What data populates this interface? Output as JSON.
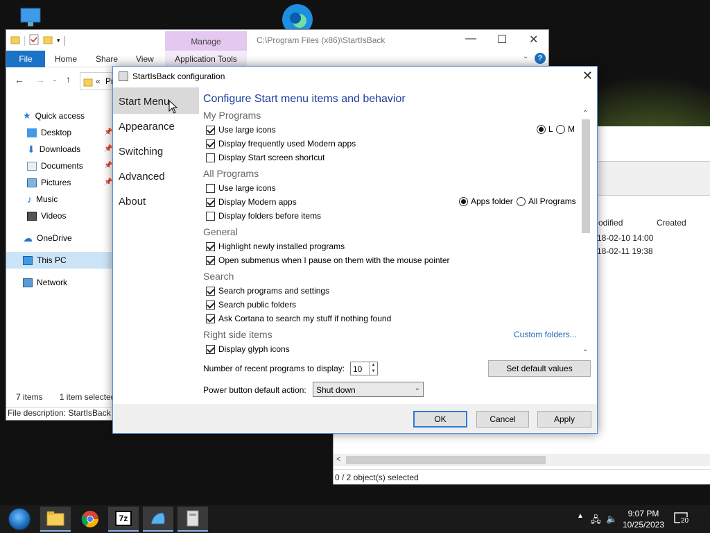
{
  "explorer": {
    "manage_tab": "Manage",
    "path": "C:\\Program Files (x86)\\StartIsBack",
    "ribbon_tabs": [
      "File",
      "Home",
      "Share",
      "View"
    ],
    "app_tools_tab": "Application Tools",
    "breadcrumb_partial": "Pr",
    "nav": [
      "Quick access",
      "Desktop",
      "Downloads",
      "Documents",
      "Pictures",
      "Music",
      "Videos",
      "OneDrive",
      "This PC",
      "Network"
    ],
    "items_count": "7 items",
    "selected_count": "1 item selected",
    "file_description": "File description: StartIsBack c"
  },
  "right_panel": {
    "col_modified": "odified",
    "col_created": "Created",
    "row1_date": "18-02-10 14:00",
    "row2_date": "18-02-11 19:38",
    "status": "0 / 2 object(s) selected"
  },
  "dialog": {
    "title": "StartIsBack configuration",
    "sidebar": [
      "Start Menu",
      "Appearance",
      "Switching",
      "Advanced",
      "About"
    ],
    "heading": "Configure Start menu items and behavior",
    "sections": {
      "my_programs": "My Programs",
      "all_programs": "All Programs",
      "general": "General",
      "search": "Search",
      "right_side": "Right side items"
    },
    "options": [
      {
        "label": "Use large icons",
        "checked": true
      },
      {
        "label": "Display frequently used Modern apps",
        "checked": true
      },
      {
        "label": "Display Start screen shortcut",
        "checked": false
      },
      {
        "label": "Use large icons",
        "checked": false
      },
      {
        "label": "Display Modern apps",
        "checked": true
      },
      {
        "label": "Display folders before items",
        "checked": false
      },
      {
        "label": "Highlight newly installed programs",
        "checked": true
      },
      {
        "label": "Open submenus when I pause on them with the mouse pointer",
        "checked": true
      },
      {
        "label": "Search programs and settings",
        "checked": true
      },
      {
        "label": "Search public folders",
        "checked": true
      },
      {
        "label": "Ask Cortana to search my stuff if nothing found",
        "checked": true
      },
      {
        "label": "Display glyph icons",
        "checked": true
      }
    ],
    "size_radios": {
      "l": "L",
      "m": "M"
    },
    "apps_radios": {
      "folder": "Apps folder",
      "all": "All Programs"
    },
    "custom_folders": "Custom folders...",
    "recent_label": "Number of recent programs to display:",
    "recent_value": "10",
    "set_default": "Set default values",
    "power_label": "Power button default action:",
    "power_value": "Shut down",
    "ok": "OK",
    "cancel": "Cancel",
    "apply": "Apply"
  },
  "taskbar": {
    "time": "9:07 PM",
    "date": "10/25/2023",
    "notifications": "20"
  },
  "colors": {
    "accent": "#1a73c7",
    "heading": "#1e3f9e",
    "link": "#1a62b3",
    "manage_tab": "#e4c8f0"
  }
}
